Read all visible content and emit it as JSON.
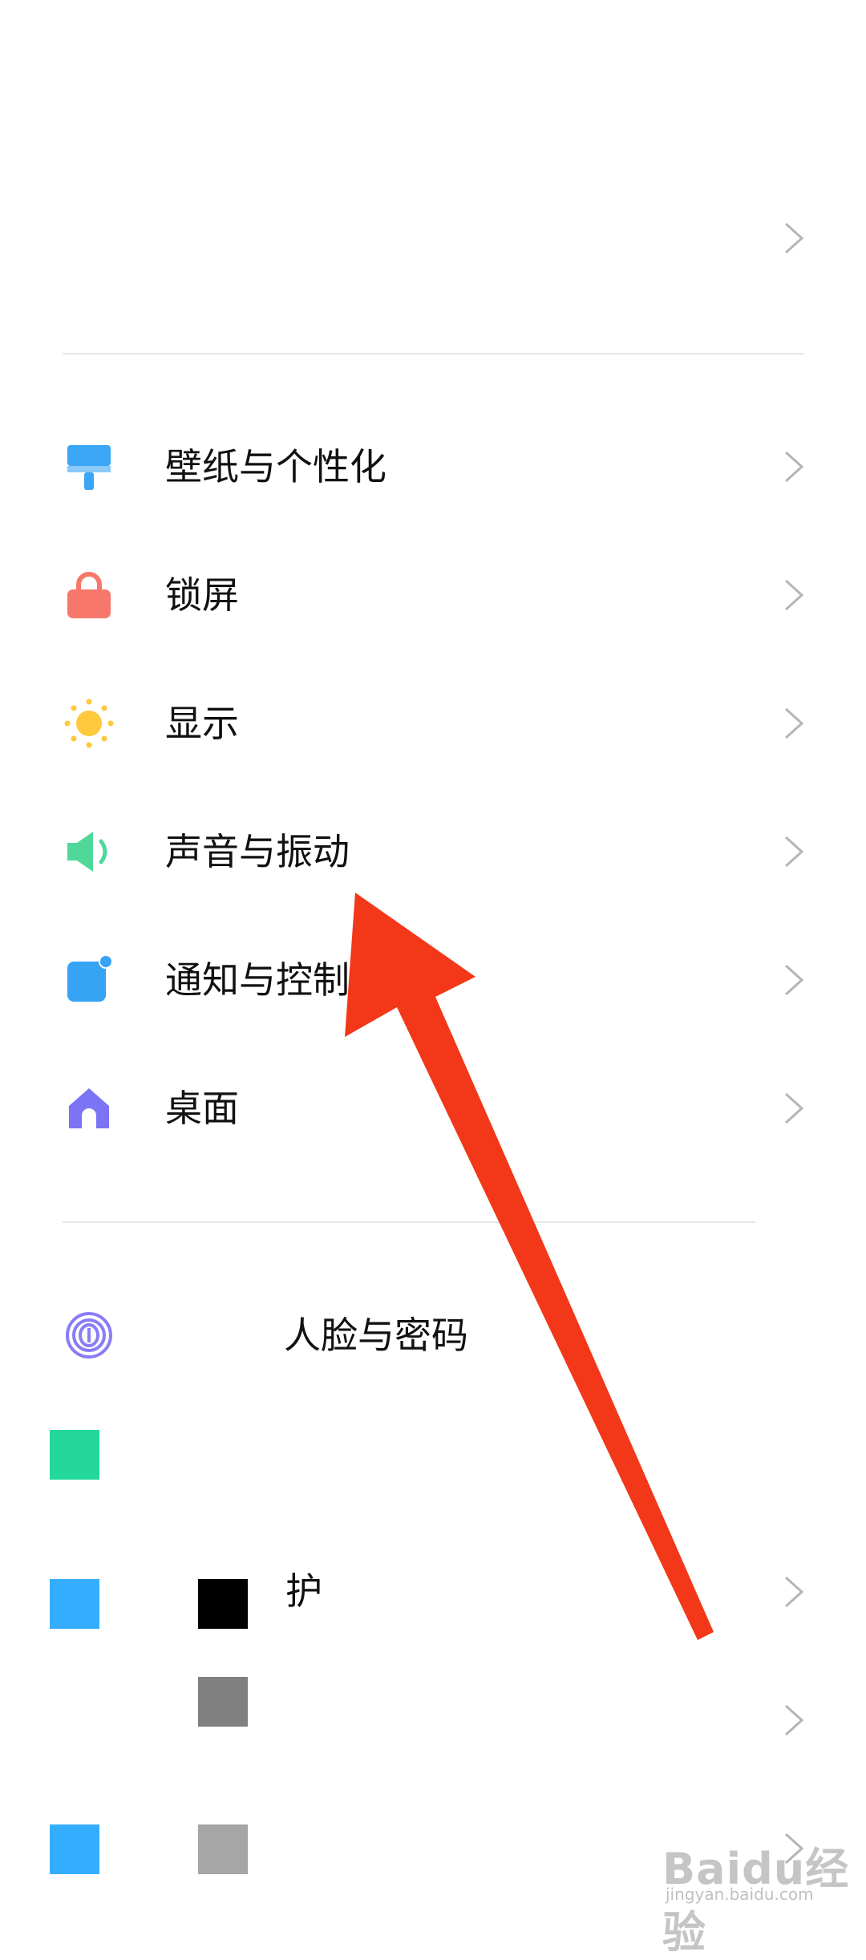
{
  "settings": {
    "top_item": {
      "label": ""
    },
    "section_one": [
      {
        "label": "壁纸与个性化",
        "icon": "paint-roller-icon",
        "color": "#3aa6f5"
      },
      {
        "label": "锁屏",
        "icon": "lock-icon",
        "color": "#f7786b"
      },
      {
        "label": "显示",
        "icon": "sun-icon",
        "color": "#ffc83d"
      },
      {
        "label": "声音与振动",
        "icon": "speaker-icon",
        "color": "#4fd899"
      },
      {
        "label": "通知与控制",
        "icon": "notification-icon",
        "color": "#36a3f5"
      },
      {
        "label": "桌面",
        "icon": "home-icon",
        "color": "#7b74f5"
      }
    ],
    "section_two": [
      {
        "label": "人脸与密码",
        "icon": "fingerprint-icon",
        "color": "#8b7cf6"
      },
      {
        "label": "",
        "icon": "placeholder-block-icon",
        "color": "#23d89a"
      },
      {
        "label": "护",
        "icon": "placeholder-block-icon",
        "color": "#35adff"
      },
      {
        "label": "",
        "icon": "placeholder-block-icon",
        "color": "#808080"
      },
      {
        "label": "",
        "icon": "placeholder-block-icon",
        "color": "#35adff"
      }
    ]
  },
  "annotation": {
    "arrow_color": "#f23818"
  },
  "watermark": {
    "brand": "Baidu经验",
    "url": "jingyan.baidu.com"
  }
}
